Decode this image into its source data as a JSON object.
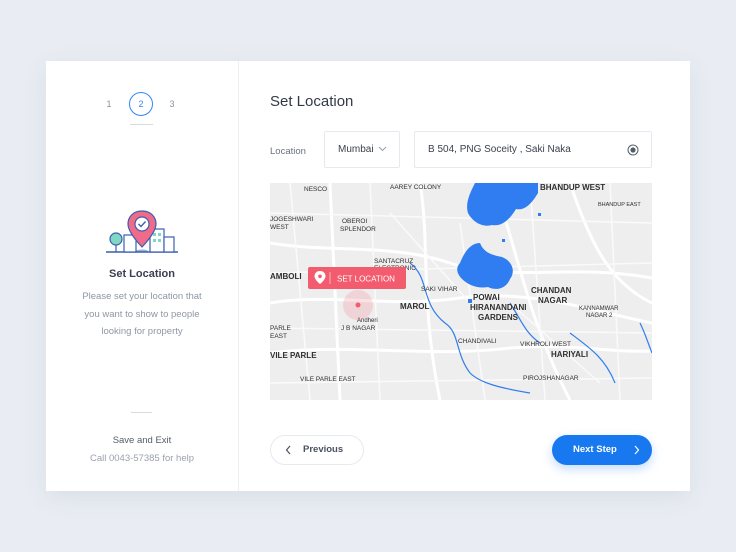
{
  "steps": [
    "1",
    "2",
    "3"
  ],
  "sidebar": {
    "title": "Set Location",
    "description": "Please set your location that you want to show to people looking for property",
    "save_exit": "Save and Exit",
    "help": "Call 0043-57385 for help"
  },
  "main": {
    "title": "Set Location",
    "location_label": "Location",
    "city": "Mumbai",
    "address": "B 504, PNG Soceity , Saki Naka"
  },
  "map": {
    "pin_label": "SET LOCATION",
    "labels": {
      "nesco": "NESCO",
      "aarey": "AAREY COLONY",
      "bhandup_w": "BHANDUP WEST",
      "bhandup_e": "BHANDUP EAST",
      "jogeshwari": "JOGESHWARI",
      "jogeshwari2": "WEST",
      "oberoi": "OBEROI",
      "oberoi2": "SPLENDOR",
      "santacruz": "SANTACRUZ",
      "santacruz2": "ELECTRONIC",
      "amboli": "AMBOLI",
      "saki": "SAKI VIHAR",
      "powai": "POWAI",
      "hiranandani": "HIRANANDANI",
      "gardens": "GARDENS",
      "chandan": "CHANDAN",
      "chandan2": "NAGAR",
      "marol": "MAROL",
      "kannamwar": "KANNAMWAR",
      "kannamwar2": "NAGAR 2",
      "parle_east_top": "PARLE",
      "parle_east_top2": "EAST",
      "andheri": "Andheri",
      "jb": "J B NAGAR",
      "vile_parle": "VILE PARLE",
      "chandivali": "CHANDIVALI",
      "vikhroli": "VIKHROLI WEST",
      "hariyali": "HARIYALI",
      "vile_parle_east": "VILE PARLE EAST",
      "pirojshanagar": "PIROJSHANAGAR"
    }
  },
  "buttons": {
    "previous": "Previous",
    "next": "Next Step"
  },
  "colors": {
    "accent": "#1878f0",
    "pin": "#f35b6e",
    "water": "#2f7df0",
    "map_bg": "#eeeeee"
  }
}
